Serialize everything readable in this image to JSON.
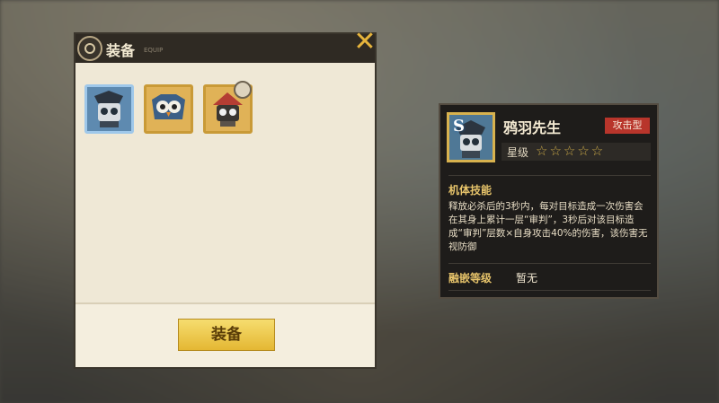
{
  "equip": {
    "title": "装备",
    "subtitle": "EQUIP",
    "button_label": "装备",
    "slots": [
      {
        "name": "鸦羽先生",
        "selected": true
      },
      {
        "name": "owl-drone",
        "selected": false
      },
      {
        "name": "bomb-bot",
        "selected": false
      }
    ]
  },
  "info": {
    "rank": "S",
    "name": "鸦羽先生",
    "type_tag": "攻击型",
    "star_label": "星级",
    "stars": "☆☆☆☆☆",
    "skill_title": "机体技能",
    "skill_desc": "释放必杀后的3秒内，每对目标造成一次伤害会在其身上累计一层“审判”，3秒后对该目标造成“审判”层数×自身攻击40%的伤害，该伤害无视防御",
    "fusion_label": "融嵌等级",
    "fusion_value": "暂无"
  },
  "colors": {
    "accent_gold": "#e4b733",
    "tag_red": "#b8352b",
    "panel_dark": "#1e1c1a"
  }
}
